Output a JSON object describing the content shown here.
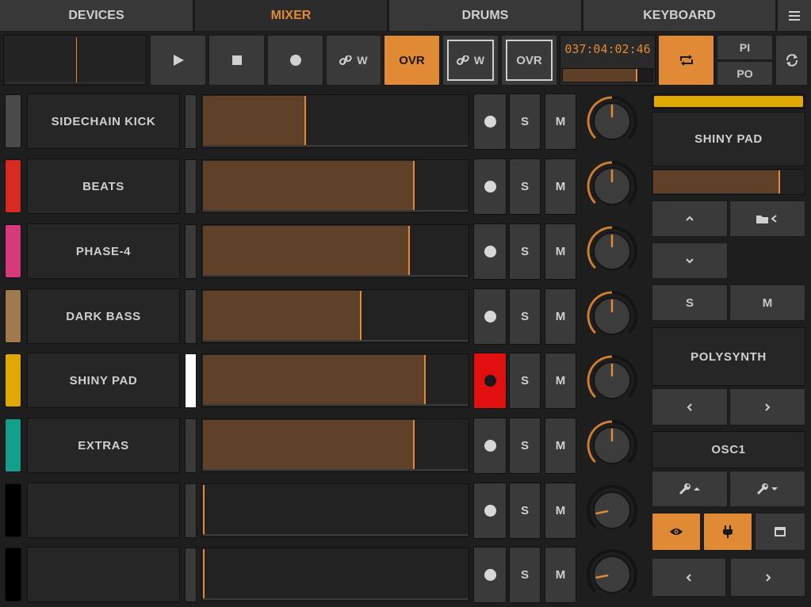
{
  "tabs": [
    {
      "label": "DEVICES",
      "active": false
    },
    {
      "label": "MIXER",
      "active": true
    },
    {
      "label": "DRUMS",
      "active": false
    },
    {
      "label": "KEYBOARD",
      "active": false
    }
  ],
  "menu_icon": "hamburger-icon",
  "transport": {
    "play_icon": "play-icon",
    "stop_icon": "stop-icon",
    "record_icon": "record-icon",
    "link_w_label": "W",
    "ovr_label": "OVR",
    "link_w2_label": "W",
    "ovr2_label": "OVR",
    "position": "037:04:02:46",
    "position_progress": 0.83,
    "loop_icon": "loop-icon",
    "pi_label": "PI",
    "po_label": "PO",
    "refresh_icon": "refresh-icon"
  },
  "tracks": [
    {
      "name": "SIDECHAIN KICK",
      "color": "#4a4a4a",
      "volume": 0.39,
      "pan": 0.0,
      "armed": false,
      "selected": false,
      "s": "S",
      "m": "M"
    },
    {
      "name": "BEATS",
      "color": "#d62a22",
      "volume": 0.8,
      "pan": 0.0,
      "armed": false,
      "selected": false,
      "s": "S",
      "m": "M"
    },
    {
      "name": "PHASE-4",
      "color": "#d63a7a",
      "volume": 0.78,
      "pan": 0.0,
      "armed": false,
      "selected": false,
      "s": "S",
      "m": "M"
    },
    {
      "name": "DARK BASS",
      "color": "#a07a4e",
      "volume": 0.6,
      "pan": 0.0,
      "armed": false,
      "selected": false,
      "s": "S",
      "m": "M"
    },
    {
      "name": "SHINY PAD",
      "color": "#e0a800",
      "volume": 0.84,
      "pan": 0.0,
      "armed": true,
      "selected": true,
      "s": "S",
      "m": "M"
    },
    {
      "name": "EXTRAS",
      "color": "#12a08c",
      "volume": 0.8,
      "pan": 0.0,
      "armed": false,
      "selected": false,
      "s": "S",
      "m": "M"
    },
    {
      "name": "",
      "color": "#000000",
      "volume": 0.0,
      "pan": -0.75,
      "armed": false,
      "selected": false,
      "s": "S",
      "m": "M"
    },
    {
      "name": "",
      "color": "#000000",
      "volume": 0.0,
      "pan": -0.75,
      "armed": false,
      "selected": false,
      "s": "S",
      "m": "M"
    }
  ],
  "right_panel": {
    "track_color": "#e0a800",
    "track_name": "SHINY PAD",
    "track_volume": 0.84,
    "up_icon": "chevron-up-icon",
    "folder_back_icon": "folder-back-icon",
    "down_icon": "chevron-down-icon",
    "s_label": "S",
    "m_label": "M",
    "device_name": "POLYSYNTH",
    "prev_icon": "chevron-left-icon",
    "next_icon": "chevron-right-icon",
    "page_name": "OSC1",
    "wrench_up_icon": "wrench-up-icon",
    "wrench_down_icon": "wrench-down-icon",
    "eye_icon": "eye-icon",
    "plug_icon": "plug-icon",
    "window_icon": "window-icon",
    "bottom_prev_icon": "chevron-left-icon",
    "bottom_next_icon": "chevron-right-icon"
  },
  "accent_color": "#e08a36"
}
